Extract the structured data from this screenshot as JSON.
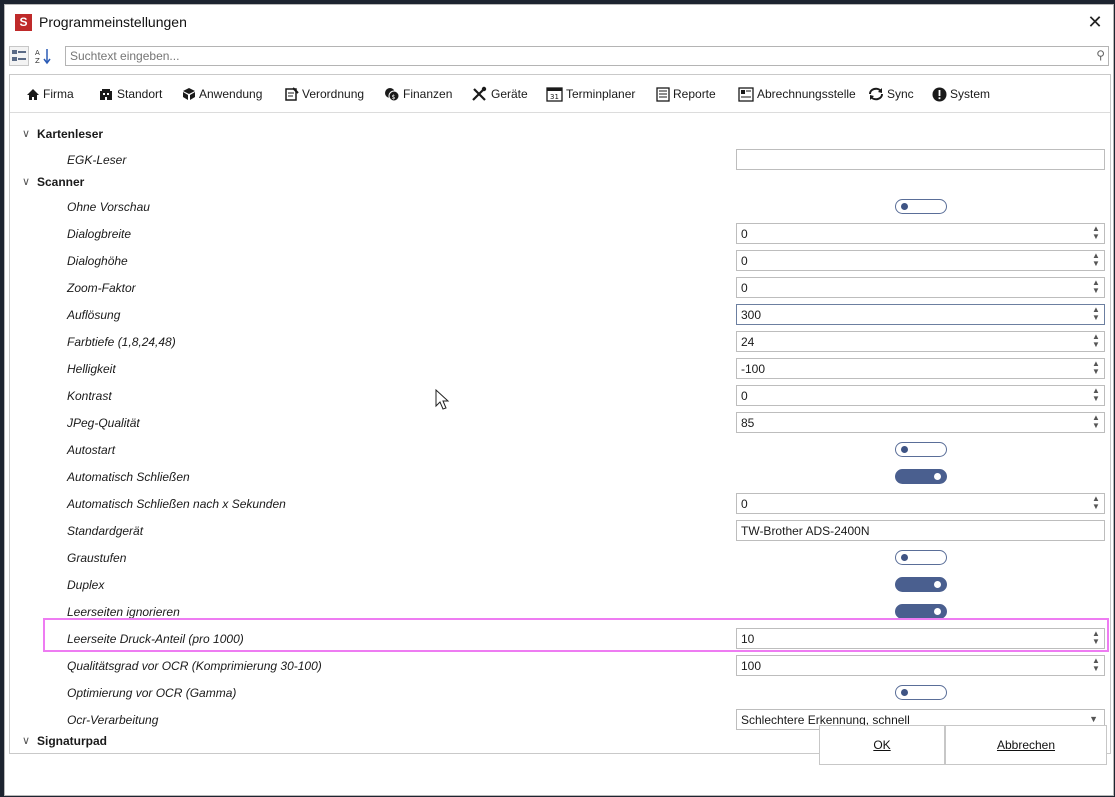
{
  "window": {
    "title": "Programmeinstellungen",
    "app_icon_letter": "S"
  },
  "search": {
    "placeholder": "Suchtext eingeben..."
  },
  "tabs": [
    {
      "label": "Firma",
      "icon": "home-icon"
    },
    {
      "label": "Standort",
      "icon": "building-icon"
    },
    {
      "label": "Anwendung",
      "icon": "cube-icon"
    },
    {
      "label": "Verordnung",
      "icon": "prescription-icon"
    },
    {
      "label": "Finanzen",
      "icon": "coins-icon"
    },
    {
      "label": "Geräte",
      "icon": "tools-icon"
    },
    {
      "label": "Terminplaner",
      "icon": "calendar-icon"
    },
    {
      "label": "Reporte",
      "icon": "report-icon"
    },
    {
      "label": "Abrechnungsstelle",
      "icon": "billing-icon"
    },
    {
      "label": "Sync",
      "icon": "sync-icon"
    },
    {
      "label": "System",
      "icon": "alert-icon"
    }
  ],
  "categories": {
    "kartenleser": "Kartenleser",
    "scanner": "Scanner",
    "signaturpad": "Signaturpad"
  },
  "properties": {
    "egk_leser": {
      "label": "EGK-Leser",
      "value": ""
    },
    "ohne_vorschau": {
      "label": "Ohne Vorschau",
      "checked": false
    },
    "dialogbreite": {
      "label": "Dialogbreite",
      "value": "0"
    },
    "dialoghoehe": {
      "label": "Dialoghöhe",
      "value": "0"
    },
    "zoom_faktor": {
      "label": "Zoom-Faktor",
      "value": "0"
    },
    "aufloesung": {
      "label": "Auflösung",
      "value": "300"
    },
    "farbtiefe": {
      "label": "Farbtiefe (1,8,24,48)",
      "value": "24"
    },
    "helligkeit": {
      "label": "Helligkeit",
      "value": "-100"
    },
    "kontrast": {
      "label": "Kontrast",
      "value": "0"
    },
    "jpeg_qualitaet": {
      "label": "JPeg-Qualität",
      "value": "85"
    },
    "autostart": {
      "label": "Autostart",
      "checked": false
    },
    "auto_schliessen": {
      "label": "Automatisch Schließen",
      "checked": true
    },
    "auto_schliessen_sek": {
      "label": "Automatisch Schließen nach x Sekunden",
      "value": "0"
    },
    "standardgeraet": {
      "label": "Standardgerät",
      "value": "TW-Brother ADS-2400N"
    },
    "graustufen": {
      "label": "Graustufen",
      "checked": false
    },
    "duplex": {
      "label": "Duplex",
      "checked": true
    },
    "leerseiten_ignorieren": {
      "label": "Leerseiten ignorieren",
      "checked": true
    },
    "leerseite_druck_anteil": {
      "label": "Leerseite Druck-Anteil (pro 1000)",
      "value": "10"
    },
    "qualitaetsgrad_ocr": {
      "label": "Qualitätsgrad vor OCR (Komprimierung 30-100)",
      "value": "100"
    },
    "optimierung_ocr": {
      "label": "Optimierung vor OCR (Gamma)",
      "checked": false
    },
    "ocr_verarbeitung": {
      "label": "Ocr-Verarbeitung",
      "value": "Schlechtere Erkennung, schnell"
    }
  },
  "buttons": {
    "ok": "OK",
    "cancel": "Abbrechen"
  },
  "colors": {
    "toggle_on": "#4a5f8f",
    "highlight": "#ee7cf2",
    "app_icon": "#bf2a2a"
  }
}
